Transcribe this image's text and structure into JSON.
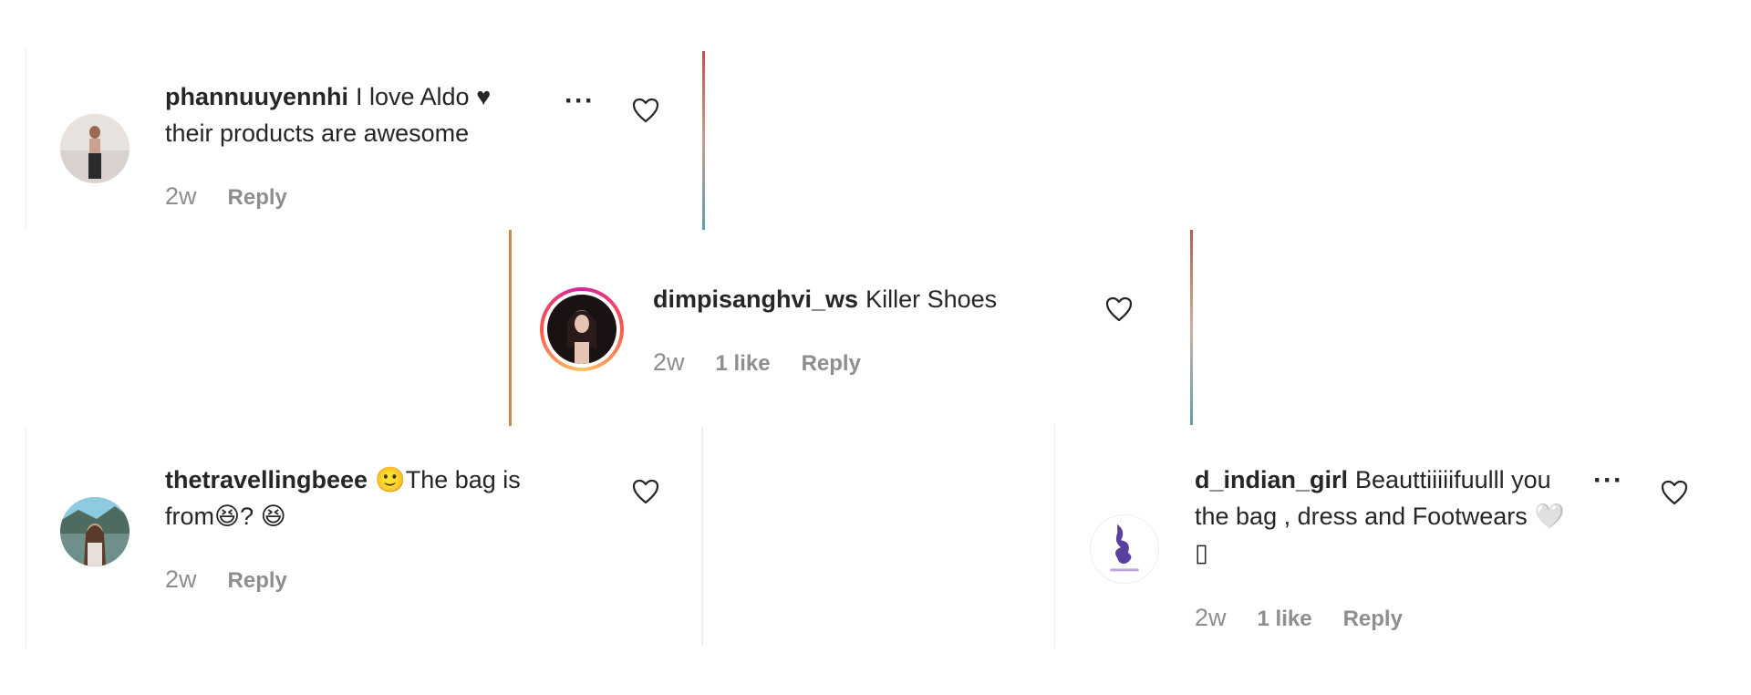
{
  "comments": [
    {
      "username": "phannuuyennhi",
      "text_line1": "I love Aldo ♥",
      "text_line2": "their products are awesome",
      "time": "2w",
      "reply": "Reply"
    },
    {
      "username": "dimpisanghvi_ws",
      "text_line1": "Killer Shoes",
      "time": "2w",
      "likes": "1 like",
      "reply": "Reply"
    },
    {
      "username": "thetravellingbeee",
      "text_line1": "🙂The bag is",
      "text_line2": "from😆? 😆",
      "time": "2w",
      "reply": "Reply"
    },
    {
      "username": "d_indian_girl",
      "text_line1": "Beauttiiiiifuulll you",
      "text_line2": "the bag , dress and Footwears 🤍",
      "text_line3": "▯",
      "time": "2w",
      "likes": "1 like",
      "reply": "Reply"
    }
  ],
  "icons": {
    "more": "more-options-icon",
    "heart": "heart-outline-icon"
  },
  "colors": {
    "text": "#262626",
    "muted": "#8e8e8e",
    "story_ring": [
      "#d6249f",
      "#fd5949",
      "#fdc468"
    ]
  }
}
